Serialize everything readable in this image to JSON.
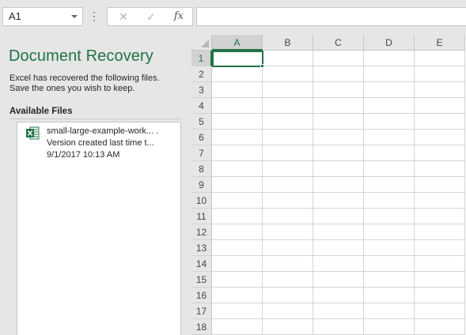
{
  "formula_bar": {
    "name_box_value": "A1",
    "cancel_symbol": "✕",
    "enter_symbol": "✓",
    "fx_label": "fx",
    "formula_value": ""
  },
  "recovery_pane": {
    "title": "Document Recovery",
    "description_line1": "Excel has recovered the following files.",
    "description_line2": "Save the ones you wish to keep.",
    "available_files_heading": "Available Files",
    "files": [
      {
        "icon": "excel-file-icon",
        "name": "small-large-example-work... .",
        "version": "Version created last time t...",
        "timestamp": "9/1/2017 10:13 AM"
      }
    ]
  },
  "grid": {
    "columns": [
      "A",
      "B",
      "C",
      "D",
      "E"
    ],
    "rows": [
      "1",
      "2",
      "3",
      "4",
      "5",
      "6",
      "7",
      "8",
      "9",
      "10",
      "11",
      "12",
      "13",
      "14",
      "15",
      "16",
      "17",
      "18"
    ],
    "active_cell": "A1"
  },
  "colors": {
    "accent": "#217346",
    "pane_background": "#e6e6e6",
    "grid_line": "#d4d4d4"
  }
}
